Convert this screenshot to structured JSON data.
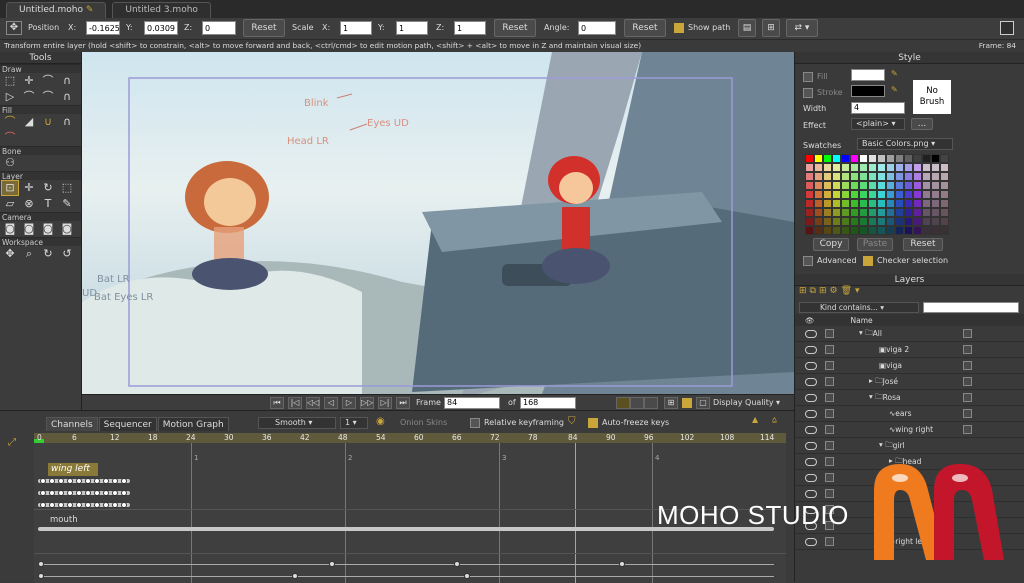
{
  "tabs": [
    {
      "label": "Untitled.moho"
    },
    {
      "label": "Untitled 3.moho"
    }
  ],
  "toolbar": {
    "position_label": "Position",
    "x_label": "X:",
    "x_value": "-0.1625",
    "y_label": "Y:",
    "y_value": "0.0309",
    "z_label": "Z:",
    "z_value": "0",
    "reset1": "Reset",
    "scale_label": "Scale",
    "sx_label": "X:",
    "sx_value": "1",
    "sy_label": "Y:",
    "sy_value": "1",
    "sz_label": "Z:",
    "sz_value": "1",
    "reset2": "Reset",
    "angle_label": "Angle:",
    "angle_value": "0",
    "reset3": "Reset",
    "show_path_label": "Show path"
  },
  "hint": "Transform entire layer (hold <shift> to constrain, <alt> to move forward and back, <ctrl/cmd> to edit motion path, <shift> + <alt> to move in Z and maintain visual size)",
  "frame_info": "Frame: 84",
  "tools": {
    "title": "Tools",
    "sections": {
      "draw": "Draw",
      "fill": "Fill",
      "bone": "Bone",
      "layer": "Layer",
      "camera": "Camera",
      "workspace": "Workspace"
    }
  },
  "canvas_labels": {
    "blink": "Blink",
    "eyes_ud": "Eyes UD",
    "head_lr": "Head LR",
    "bat_lr": "Bat LR",
    "bat_eyes_lr": "Bat Eyes LR",
    "ud": "UD"
  },
  "playbar": {
    "frame_label": "Frame",
    "frame_value": "84",
    "of_label": "of",
    "total_value": "168",
    "display_quality": "Display Quality"
  },
  "timeline": {
    "tabs": [
      "Channels",
      "Sequencer",
      "Motion Graph"
    ],
    "interp": "Smooth",
    "interp_num": "1",
    "onion": "Onion Skins",
    "relative": "Relative keyframing",
    "autofreeze": "Auto-freeze keys",
    "ruler": [
      "0",
      "6",
      "12",
      "18",
      "24",
      "30",
      "36",
      "42",
      "48",
      "54",
      "60",
      "66",
      "72",
      "78",
      "84",
      "90",
      "96",
      "102",
      "108",
      "114"
    ],
    "markers": [
      "1",
      "2",
      "3",
      "4"
    ],
    "wing_left": "wing left",
    "mouth": "mouth"
  },
  "style": {
    "title": "Style",
    "fill": "Fill",
    "stroke": "Stroke",
    "width_label": "Width",
    "width_value": "4",
    "effect_label": "Effect",
    "effect_value": "<plain>",
    "more": "...",
    "no_brush": "No Brush",
    "swatches_label": "Swatches",
    "swatches_value": "Basic Colors.png",
    "copy": "Copy",
    "paste": "Paste",
    "reset": "Reset",
    "advanced": "Advanced",
    "checker": "Checker selection"
  },
  "layers": {
    "title": "Layers",
    "kind": "Kind contains...",
    "name_col": "Name",
    "rows": [
      {
        "label": "All"
      },
      {
        "label": "viga 2"
      },
      {
        "label": "viga"
      },
      {
        "label": "José"
      },
      {
        "label": "Rosa"
      },
      {
        "label": "ears"
      },
      {
        "label": "wing right"
      },
      {
        "label": "girl"
      },
      {
        "label": "head"
      },
      {
        "label": ""
      },
      {
        "label": ""
      },
      {
        "label": ""
      },
      {
        "label": ""
      },
      {
        "label": "right leg"
      }
    ]
  },
  "watermark": "MOHO STUDIO",
  "colors": {
    "accent": "#c9a53a",
    "brand_orange": "#f07a1e",
    "brand_red": "#c4162a"
  }
}
